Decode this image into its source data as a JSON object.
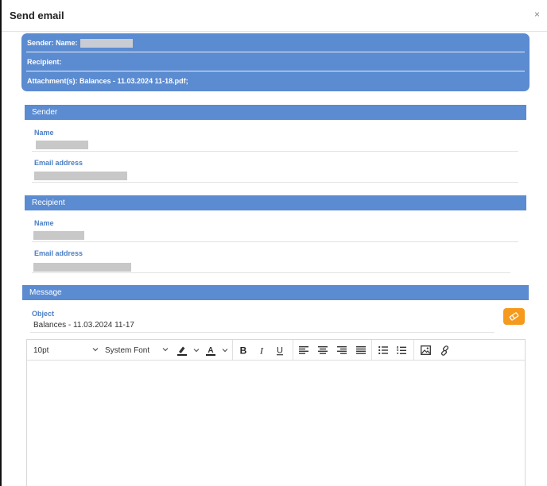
{
  "dialog": {
    "title": "Send email",
    "close_icon": "×"
  },
  "summary": {
    "sender_label": "Sender: Name:",
    "recipient_label": "Recipient:",
    "attachments_label": "Attachment(s): Balances - 11.03.2024 11-18.pdf;"
  },
  "sender": {
    "section_title": "Sender",
    "name_label": "Name",
    "email_label": "Email address"
  },
  "recipient": {
    "section_title": "Recipient",
    "name_label": "Name",
    "email_label": "Email address"
  },
  "message": {
    "section_title": "Message",
    "object_label": "Object",
    "object_value": "Balances - 11.03.2024 11-17"
  },
  "editor": {
    "font_size": "10pt",
    "font_family": "System Font"
  },
  "colors": {
    "accent": "#5b8bd0",
    "label": "#4a7ec4",
    "edit_button": "#f59a1d",
    "redacted": "#c8c8c8"
  },
  "icons": [
    "close-icon",
    "eraser-icon",
    "chevron-down-icon",
    "highlight-color-icon",
    "text-color-icon",
    "bold-icon",
    "italic-icon",
    "underline-icon",
    "align-left-icon",
    "align-center-icon",
    "align-right-icon",
    "align-justify-icon",
    "bullet-list-icon",
    "numbered-list-icon",
    "insert-image-icon",
    "insert-link-icon"
  ]
}
